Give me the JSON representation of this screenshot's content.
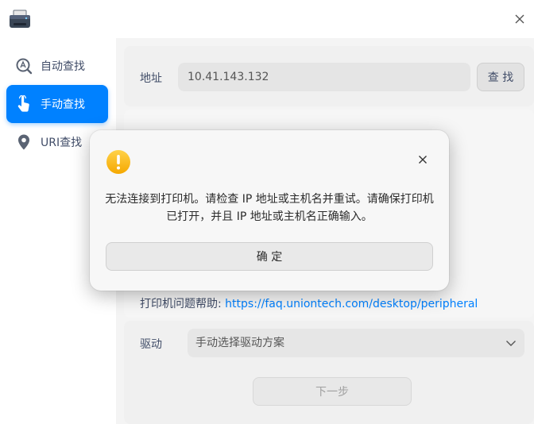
{
  "sidebar": {
    "items": [
      {
        "label": "自动查找",
        "icon": "search-magnifier-icon"
      },
      {
        "label": "手动查找",
        "icon": "pointer-hand-icon",
        "active": true
      },
      {
        "label": "URI查找",
        "icon": "location-pin-icon"
      }
    ]
  },
  "address": {
    "label": "地址",
    "value": "10.41.143.132",
    "search_label": "查 找"
  },
  "help": {
    "prefix": "打印机问题帮助: ",
    "link": "https://faq.uniontech.com/desktop/peripheral"
  },
  "driver": {
    "label": "驱动",
    "selected": "手动选择驱动方案"
  },
  "next_label": "下一步",
  "dialog": {
    "message": "无法连接到打印机。请检查 IP 地址或主机名并重试。请确保打印机已打开，并且 IP 地址或主机名正确输入。",
    "ok_label": "确 定"
  },
  "colors": {
    "accent": "#0081ff",
    "warning": "#f5b300"
  }
}
